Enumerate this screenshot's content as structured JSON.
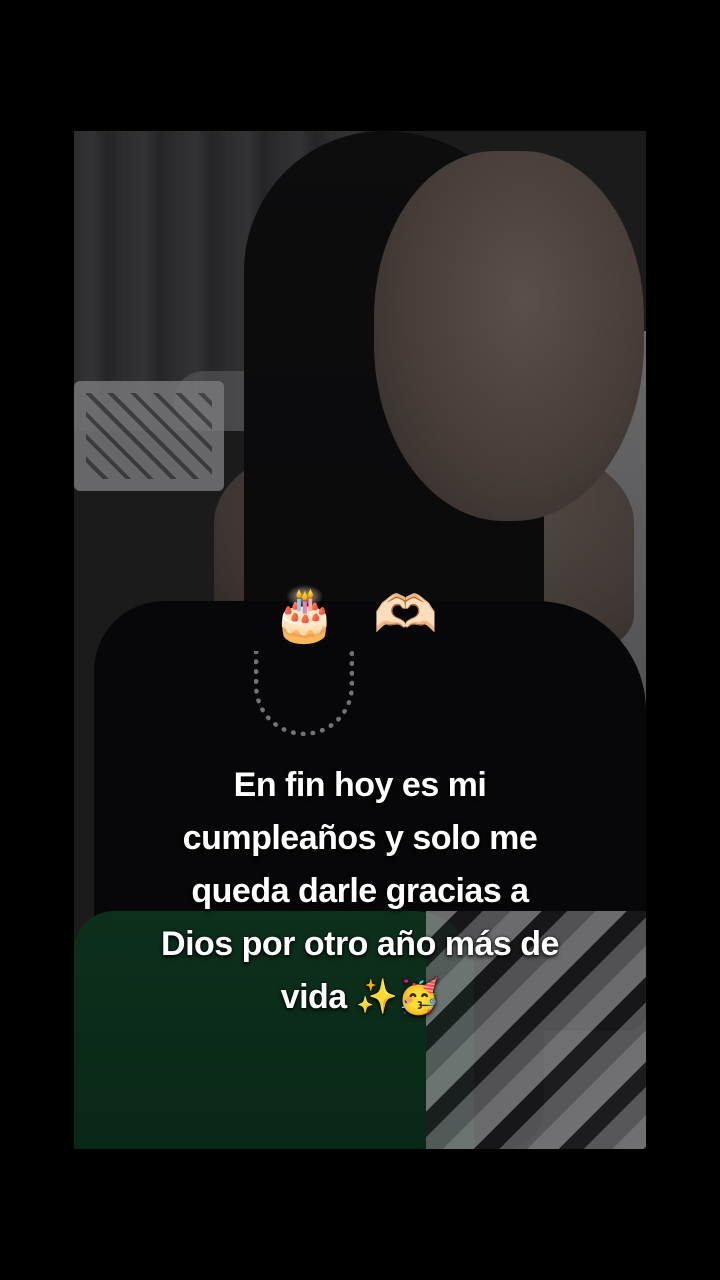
{
  "overlay": {
    "emoji_line": "🎂 🫶🏻",
    "caption_lines": [
      "En fin hoy es mi",
      "cumpleaños y solo me",
      "queda darle gracias a",
      "Dios por otro año más de",
      "vida ✨🥳"
    ]
  },
  "colors": {
    "page_background": "#000000",
    "caption_text": "#ffffff",
    "skirt": "#144a2c"
  },
  "icons": [
    "birthday-cake-icon",
    "heart-hands-icon",
    "sparkles-icon",
    "party-face-icon"
  ]
}
